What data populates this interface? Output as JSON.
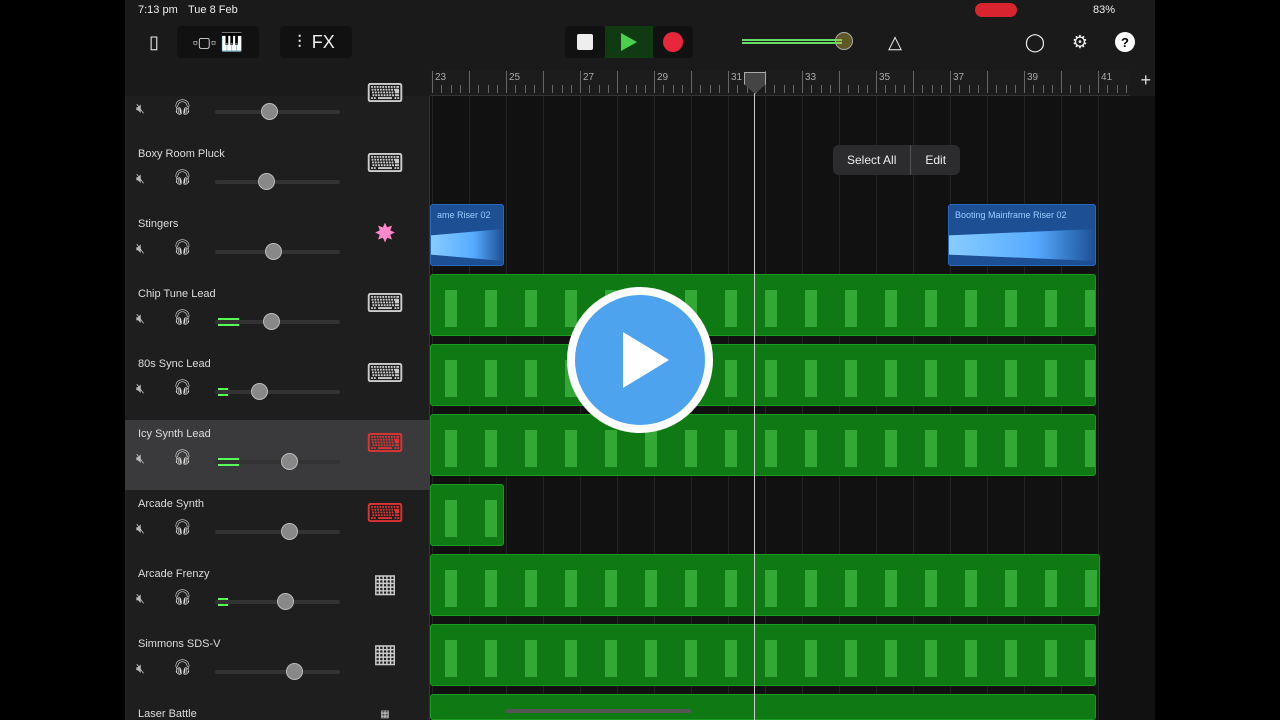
{
  "status": {
    "time": "7:13 pm",
    "date": "Tue 8 Feb",
    "battery": "83%"
  },
  "toolbar": {
    "fx_label": "FX",
    "icons": [
      "document-icon",
      "tracks-view-icon",
      "piano-keys-icon",
      "mixer-icon",
      "stop-icon",
      "play-icon",
      "record-icon",
      "metronome-icon",
      "loop-icon",
      "settings-icon",
      "help-icon"
    ],
    "master_volume_pct": 85
  },
  "ruler": {
    "bars": [
      "23",
      "25",
      "27",
      "29",
      "31",
      "33",
      "35",
      "37",
      "39",
      "41"
    ]
  },
  "popup": {
    "select_all": "Select All",
    "edit": "Edit"
  },
  "colors": {
    "region_green": "#0f7a14",
    "region_blue": "#1d4f95",
    "play_green": "#4ccf4c",
    "record_red": "#e8283a",
    "accent_blue": "#4da3ee"
  },
  "tracks": [
    {
      "name": "",
      "volume": 0.43,
      "meter": 0,
      "inst": "keyboard-stand-icon"
    },
    {
      "name": "Boxy Room Pluck",
      "volume": 0.41,
      "meter": 0,
      "inst": "keyboard-stand-icon"
    },
    {
      "name": "Stingers",
      "volume": 0.46,
      "meter": 0,
      "inst": "sparkle-burst-icon"
    },
    {
      "name": "Chip Tune Lead",
      "volume": 0.45,
      "meter": 0.17,
      "inst": "keyboard-stand-icon"
    },
    {
      "name": "80s Sync Lead",
      "volume": 0.35,
      "meter": 0.08,
      "inst": "keyboard-stand-icon"
    },
    {
      "name": "Icy Synth Lead",
      "volume": 0.59,
      "meter": 0.17,
      "inst": "red-keyboard-icon",
      "selected": true
    },
    {
      "name": "Arcade Synth",
      "volume": 0.59,
      "meter": 0,
      "inst": "red-keyboard-icon"
    },
    {
      "name": "Arcade Frenzy",
      "volume": 0.56,
      "meter": 0.08,
      "inst": "drum-machine-icon"
    },
    {
      "name": "Simmons SDS-V",
      "volume": 0.63,
      "meter": 0,
      "inst": "drum-machine-icon"
    },
    {
      "name": "Laser Battle",
      "volume": 0.5,
      "meter": 0,
      "inst": "drum-machine-icon"
    }
  ],
  "regions": [
    {
      "track": 2,
      "start": 23,
      "end": 25,
      "type": "audio",
      "label": "ame Riser 02"
    },
    {
      "track": 2,
      "start": 37,
      "end": 41,
      "type": "audio",
      "label": "Booting Mainframe Riser 02"
    },
    {
      "track": 3,
      "start": 23,
      "end": 41,
      "type": "midi"
    },
    {
      "track": 4,
      "start": 23,
      "end": 41,
      "type": "midi"
    },
    {
      "track": 5,
      "start": 23,
      "end": 41,
      "type": "midi"
    },
    {
      "track": 6,
      "start": 23,
      "end": 25,
      "type": "midi"
    },
    {
      "track": 7,
      "start": 23,
      "end": 41.1,
      "type": "midi"
    },
    {
      "track": 8,
      "start": 23,
      "end": 41,
      "type": "midi"
    },
    {
      "track": 9,
      "start": 23,
      "end": 41,
      "type": "midi"
    }
  ],
  "playhead_bar": 28.4
}
